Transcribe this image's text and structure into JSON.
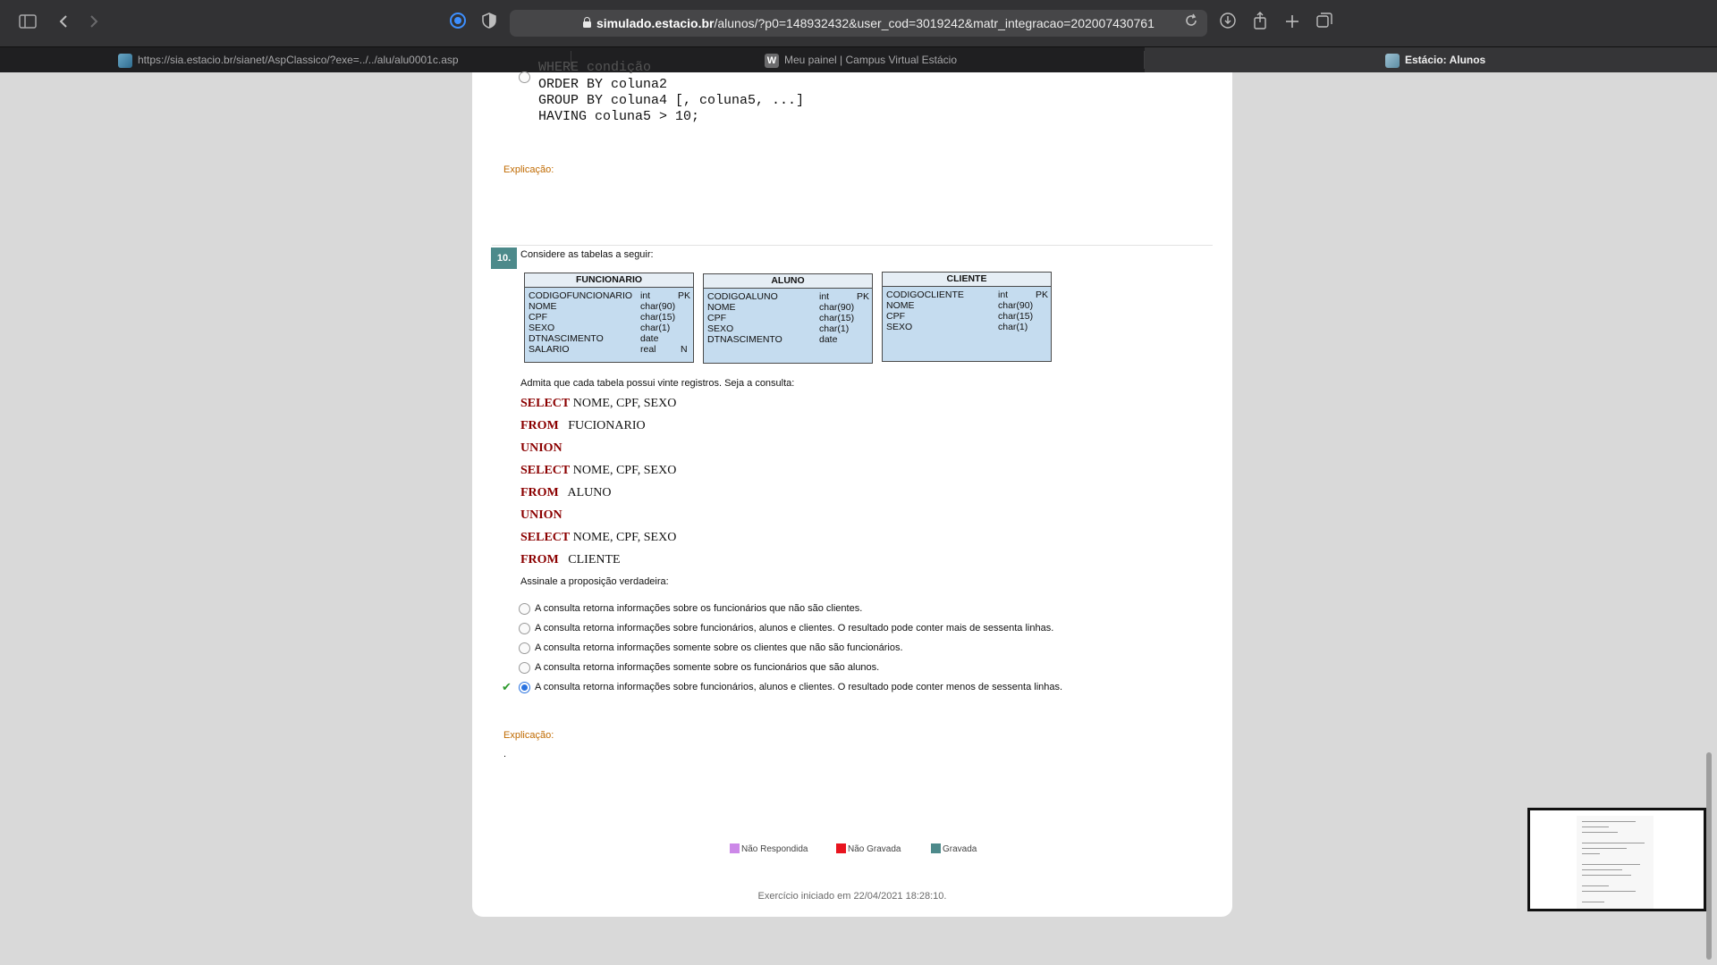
{
  "browser": {
    "url_host": "simulado.estacio.br",
    "url_path": "/alunos/?p0=148932432&user_cod=3019242&matr_integracao=202007430761",
    "tabs": [
      {
        "label": "https://sia.estacio.br/sianet/AspClassico/?exe=../../alu/alu0001c.asp"
      },
      {
        "label": "Meu painel | Campus Virtual Estácio"
      },
      {
        "label": "Estácio: Alunos"
      }
    ]
  },
  "prev_question": {
    "code_lines": [
      "WHERE condição",
      "ORDER BY coluna2",
      "GROUP BY coluna4 [, coluna5, ...]",
      "HAVING coluna5 > 10;"
    ],
    "explanation_label": "Explicação:"
  },
  "question": {
    "number": "10.",
    "intro": "Considere as tabelas a seguir:",
    "tables": [
      {
        "name": "FUNCIONARIO",
        "rows": [
          [
            "CODIGOFUNCIONARIO",
            "int",
            "PK"
          ],
          [
            "NOME",
            "char(90)",
            ""
          ],
          [
            "CPF",
            "char(15)",
            ""
          ],
          [
            "SEXO",
            "char(1)",
            ""
          ],
          [
            "DTNASCIMENTO",
            "date",
            ""
          ],
          [
            "SALARIO",
            "real",
            "N"
          ]
        ]
      },
      {
        "name": "ALUNO",
        "rows": [
          [
            "CODIGOALUNO",
            "int",
            "PK"
          ],
          [
            "NOME",
            "char(90)",
            ""
          ],
          [
            "CPF",
            "char(15)",
            ""
          ],
          [
            "SEXO",
            "char(1)",
            ""
          ],
          [
            "DTNASCIMENTO",
            "date",
            ""
          ]
        ]
      },
      {
        "name": "CLIENTE",
        "rows": [
          [
            "CODIGOCLIENTE",
            "int",
            "PK"
          ],
          [
            "NOME",
            "char(90)",
            ""
          ],
          [
            "CPF",
            "char(15)",
            ""
          ],
          [
            "SEXO",
            "char(1)",
            ""
          ]
        ]
      }
    ],
    "premise": "Admita que cada tabela possui vinte registros. Seja a consulta:",
    "sql": [
      {
        "kw": "SELECT",
        "rest": "NOME, CPF, SEXO"
      },
      {
        "kw": "FROM",
        "rest": "FUCIONARIO"
      },
      {
        "kw": "UNION",
        "rest": ""
      },
      {
        "kw": "SELECT",
        "rest": "NOME, CPF, SEXO"
      },
      {
        "kw": "FROM",
        "rest": "ALUNO"
      },
      {
        "kw": "UNION",
        "rest": ""
      },
      {
        "kw": "SELECT",
        "rest": "NOME, CPF, SEXO"
      },
      {
        "kw": "FROM",
        "rest": "CLIENTE"
      }
    ],
    "instruction": "Assinale a proposição verdadeira:",
    "options": [
      "A consulta retorna informações sobre os funcionários que não são clientes.",
      "A consulta retorna informações sobre funcionários, alunos e clientes. O resultado pode conter mais de sessenta linhas.",
      "A consulta retorna informações somente sobre os clientes que não são funcionários.",
      "A consulta retorna informações somente sobre os funcionários que são alunos.",
      "A consulta retorna informações sobre funcionários, alunos e clientes. O resultado pode conter menos de sessenta linhas."
    ],
    "selected_option": 5,
    "explanation_label": "Explicação:",
    "explanation_text": "."
  },
  "legend": [
    {
      "label": "Não Respondida",
      "color": "#cc88e8"
    },
    {
      "label": "Não Gravada",
      "color": "#e8141e"
    },
    {
      "label": "Gravada",
      "color": "#4d8a8b"
    }
  ],
  "footer": {
    "started": "Exercício iniciado em 22/04/2021 18:28:10."
  }
}
